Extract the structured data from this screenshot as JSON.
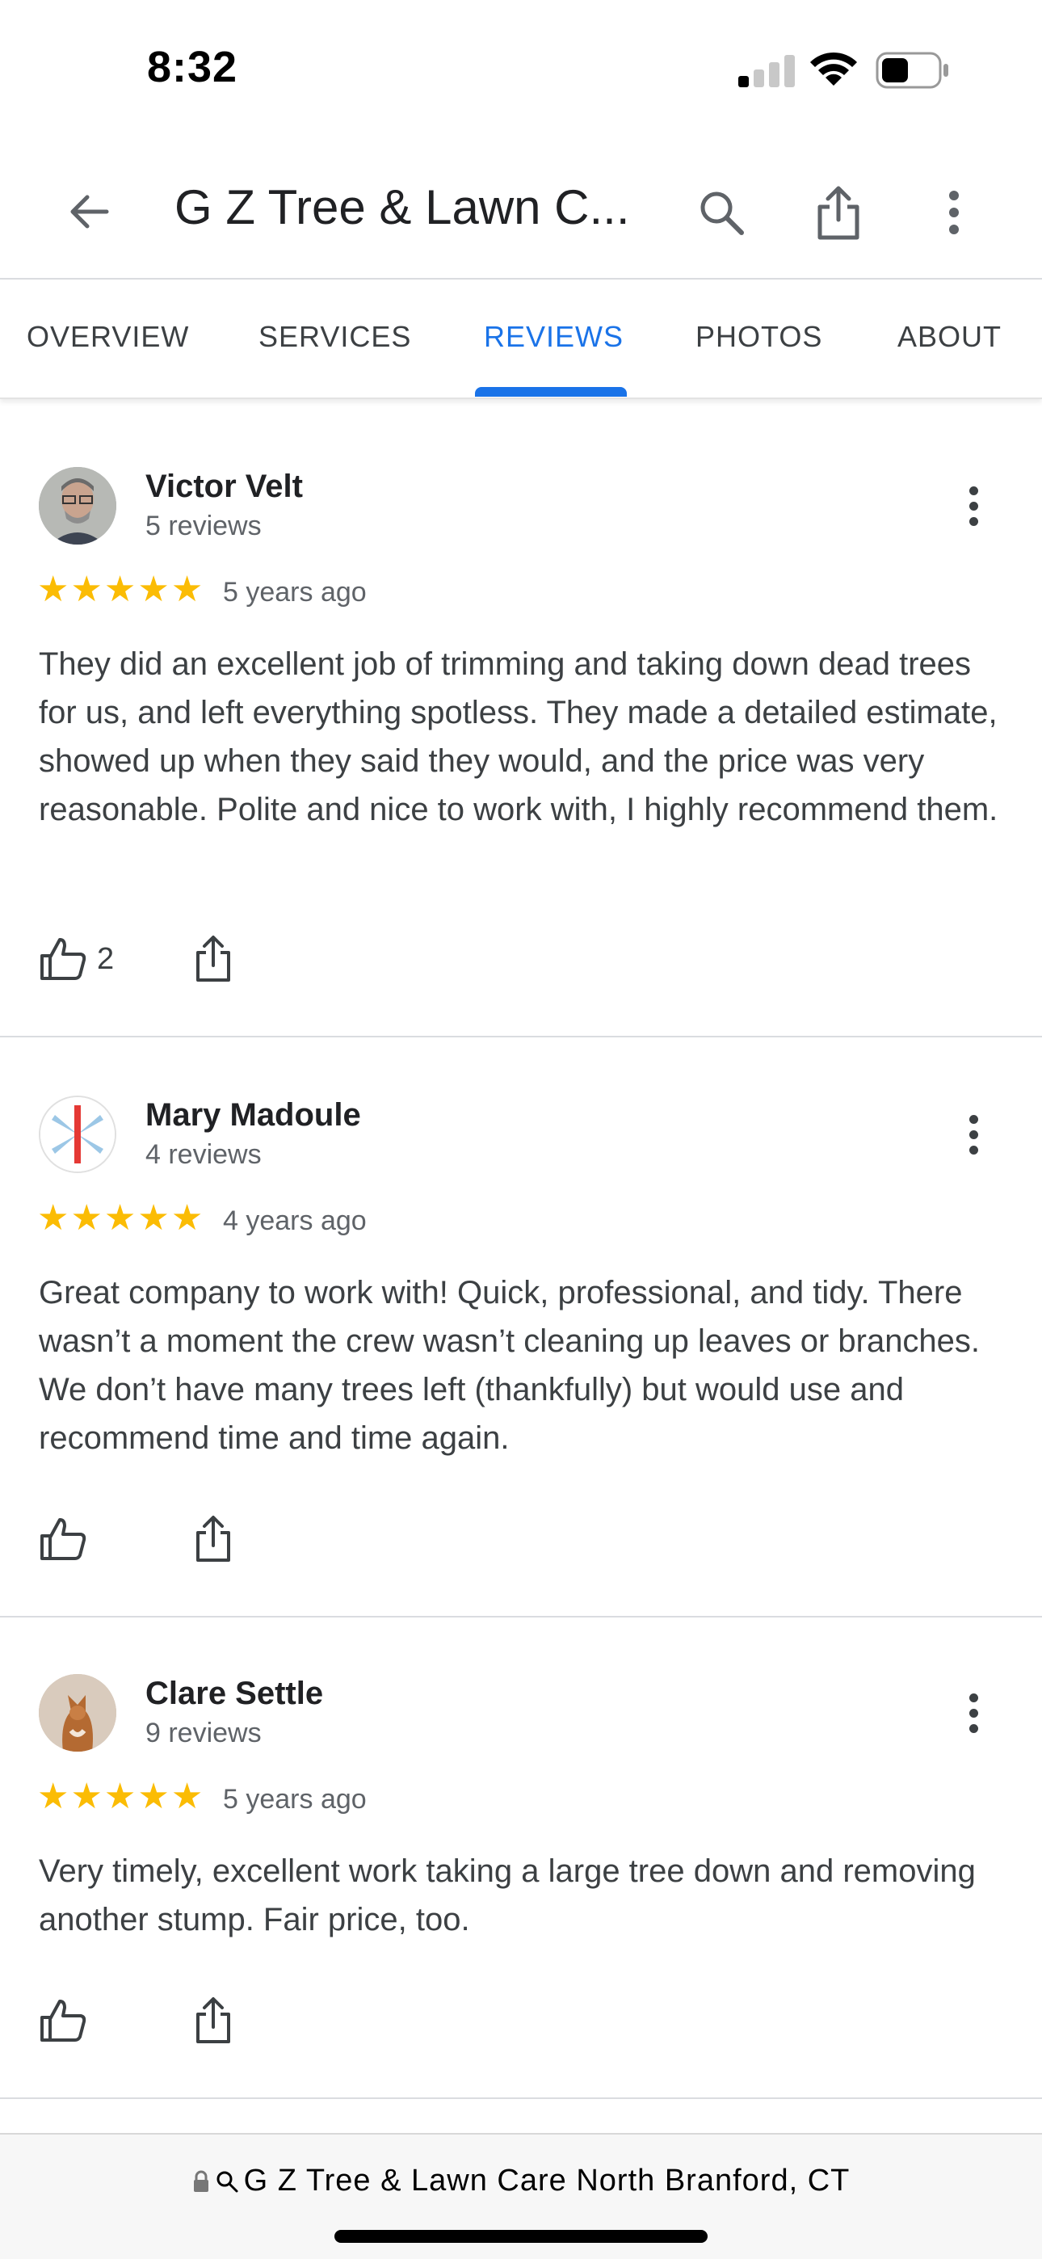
{
  "status_bar": {
    "time": "8:32"
  },
  "header": {
    "title": "G Z Tree & Lawn C..."
  },
  "tabs": [
    {
      "label": "OVERVIEW"
    },
    {
      "label": "SERVICES"
    },
    {
      "label": "REVIEWS"
    },
    {
      "label": "PHOTOS"
    },
    {
      "label": "ABOUT"
    }
  ],
  "active_tab": "REVIEWS",
  "colors": {
    "accent": "#1a73e8",
    "star": "#fbbc04"
  },
  "reviews": [
    {
      "name": "Victor Velt",
      "count": "5 reviews",
      "rating": 5,
      "date": "5 years ago",
      "text": "They did an excellent job of trimming and taking down dead trees for us, and left everything spotless. They made a detailed estimate, showed up when they said they would, and the price was very reasonable. Polite and nice to work with, I highly recommend them.",
      "likes": "2"
    },
    {
      "name": "Mary Madoule",
      "count": "4 reviews",
      "rating": 5,
      "date": "4 years ago",
      "text": "Great company to work with! Quick, professional, and tidy. There wasn’t a moment the crew wasn’t cleaning up leaves or branches. We don’t have many trees left (thankfully) but would use and recommend time and time again.",
      "likes": ""
    },
    {
      "name": "Clare Settle",
      "count": "9 reviews",
      "rating": 5,
      "date": "5 years ago",
      "text": "Very timely, excellent work taking a large tree down and removing another stump. Fair price, too.",
      "likes": ""
    }
  ],
  "url_bar": {
    "text": "G Z Tree & Lawn Care North Branford, CT"
  },
  "icons": [
    "signal-icon",
    "wifi-icon",
    "battery-icon",
    "back-arrow-icon",
    "search-icon",
    "share-icon",
    "more-vert-icon",
    "thumb-up-icon",
    "lock-icon"
  ]
}
